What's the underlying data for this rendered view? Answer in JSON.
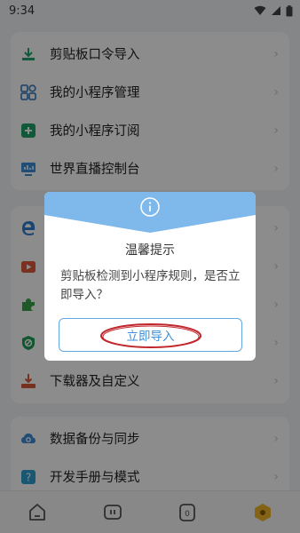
{
  "status": {
    "time": "9:34"
  },
  "top_menu": [
    {
      "label": "剪贴板口令导入",
      "icon": "download-tray-icon",
      "color": "#22a06b"
    },
    {
      "label": "我的小程序管理",
      "icon": "grid-apps-icon",
      "color": "#4a86c6"
    },
    {
      "label": "我的小程序订阅",
      "icon": "subscribe-plus-icon",
      "color": "#22a06b"
    },
    {
      "label": "世界直播控制台",
      "icon": "monitor-chart-icon",
      "color": "#3c8fd8"
    }
  ],
  "mid_menu": [
    {
      "label": "",
      "icon": "edge-browser-icon",
      "color": "#2f7fd0"
    },
    {
      "label": "",
      "icon": "video-play-icon",
      "color": "#e05a3b"
    },
    {
      "label": "",
      "icon": "puzzle-plugin-icon",
      "color": "#3aa34a"
    },
    {
      "label": "",
      "icon": "shield-block-icon",
      "color": "#1e9e57"
    },
    {
      "label": "下载器及自定义",
      "icon": "downloader-icon",
      "color": "#d85a3a"
    }
  ],
  "bottom_menu": [
    {
      "label": "数据备份与同步",
      "icon": "cloud-sync-icon",
      "color": "#3c8fd8"
    },
    {
      "label": "开发手册与模式",
      "icon": "help-book-icon",
      "color": "#2f9fd0"
    }
  ],
  "nav": [
    "home-icon",
    "chat-icon",
    "zero-badge-icon",
    "hexagon-profile-icon"
  ],
  "dialog": {
    "title": "温馨提示",
    "message": "剪贴板检测到小程序规则，是否立即导入？",
    "button": "立即导入",
    "accent": "#63a7e3"
  },
  "colors": {
    "overlay": "rgba(0,0,0,0.45)",
    "annotation": "#c0262b"
  }
}
